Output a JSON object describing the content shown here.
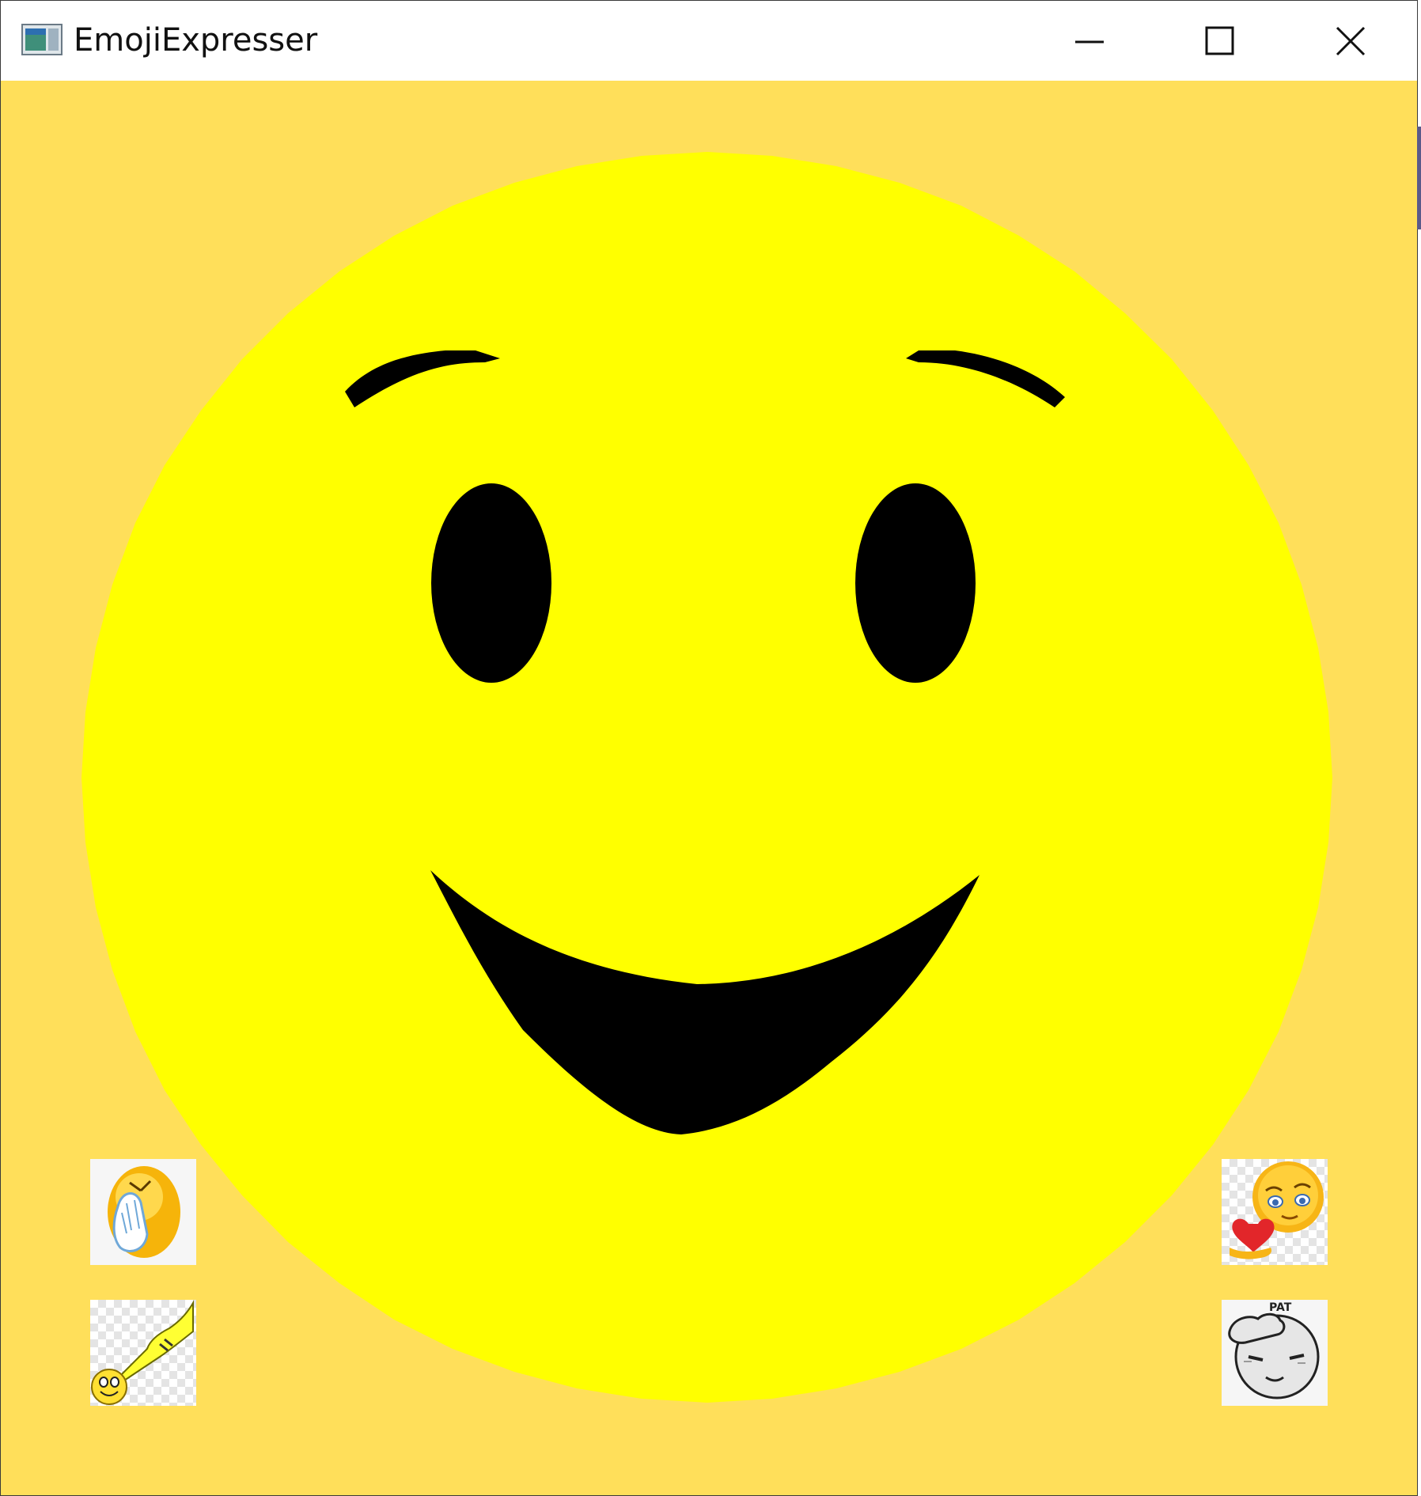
{
  "window": {
    "title": "EmojiExpresser",
    "icon": "app-window-icon",
    "controls": {
      "minimize": "minimize-icon",
      "maximize": "maximize-icon",
      "close": "close-icon"
    }
  },
  "face": {
    "expression": "smile",
    "face_color": "#ffff00",
    "background_color": "#ffdf5a",
    "feature_color": "#000000"
  },
  "emoji_buttons": [
    {
      "name": "facepalm",
      "icon": "facepalm-emoji-icon"
    },
    {
      "name": "love",
      "icon": "heart-emoji-icon"
    },
    {
      "name": "point",
      "icon": "pointing-hand-emoji-icon"
    },
    {
      "name": "pat",
      "icon": "head-pat-emoji-icon",
      "text": "PAT"
    }
  ]
}
